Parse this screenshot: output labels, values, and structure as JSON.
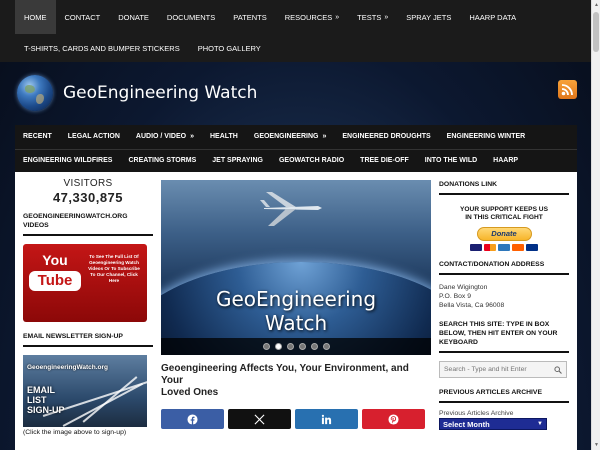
{
  "colors": {
    "nav_bg": "#1b1b1b",
    "content_bg": "#ffffff",
    "facebook": "#3b5ea5",
    "twitter": "#111111",
    "linkedin": "#2870b0",
    "pinterest": "#d7202e",
    "rss": "#f28a2a",
    "archive_select": "#1e2c94"
  },
  "topnav": {
    "row1": [
      {
        "label": "HOME",
        "active": true
      },
      {
        "label": "CONTACT"
      },
      {
        "label": "DONATE"
      },
      {
        "label": "DOCUMENTS"
      },
      {
        "label": "PATENTS"
      },
      {
        "label": "RESOURCES",
        "arrow": "»"
      },
      {
        "label": "TESTS",
        "arrow": "»"
      },
      {
        "label": "SPRAY JETS"
      },
      {
        "label": "HAARP DATA"
      }
    ],
    "row2": [
      {
        "label": "T-SHIRTS, CARDS AND BUMPER STICKERS"
      },
      {
        "label": "PHOTO GALLERY"
      }
    ]
  },
  "header": {
    "site_title": "GeoEngineering Watch",
    "logo_icon": "globe-icon",
    "feed_icon": "rss-icon"
  },
  "mainnav": {
    "row1": [
      {
        "label": "RECENT"
      },
      {
        "label": "LEGAL ACTION"
      },
      {
        "label": "AUDIO / VIDEO",
        "arrow": "»"
      },
      {
        "label": "HEALTH"
      },
      {
        "label": "GEOENGINEERING",
        "arrow": "»"
      },
      {
        "label": "ENGINEERED DROUGHTS"
      },
      {
        "label": "ENGINEERING WINTER"
      }
    ],
    "row2": [
      {
        "label": "ENGINEERING WILDFIRES"
      },
      {
        "label": "CREATING STORMS"
      },
      {
        "label": "JET SPRAYING"
      },
      {
        "label": "GEOWATCH RADIO"
      },
      {
        "label": "TREE DIE-OFF"
      },
      {
        "label": "INTO THE WILD"
      },
      {
        "label": "HAARP"
      }
    ]
  },
  "left": {
    "visitors_label": "VISITORS",
    "visitors_count": "47,330,875",
    "videos_heading_l1": "GEOENGINEERINGWATCH.ORG",
    "videos_heading_l2": "VIDEOS",
    "yt_you": "You",
    "yt_tube": "Tube",
    "yt_text": "To See The Full List Of Geoengineering Watch Videos Or To Subscribe To Our Channel, Click Here",
    "newsletter_heading": "EMAIL NEWSLETTER SIGN-UP",
    "signup_site": "GeoengineeringWatch.org",
    "signup_l1": "EMAIL",
    "signup_l2": "LIST",
    "signup_l3": "SIGN-UP",
    "signup_caption": "(Click the image above to sign-up)"
  },
  "center": {
    "slide_title_l1": "GeoEngineering",
    "slide_title_l2": "Watch",
    "slide_count": 6,
    "active_slide": 2,
    "headline_l1": "Geoengineering Affects You, Your Environment, and Your",
    "headline_l2": "Loved Ones",
    "share_buttons": [
      "facebook-icon",
      "x-icon",
      "linkedin-icon",
      "pinterest-icon"
    ]
  },
  "right": {
    "donations_heading": "DONATIONS LINK",
    "support_l1": "YOUR SUPPORT KEEPS US",
    "support_l2": "IN THIS CRITICAL FIGHT",
    "donate_label": "Donate",
    "address_heading": "CONTACT/DONATION ADDRESS",
    "address_l1": "Dane Wigington",
    "address_l2": "P.O. Box 9",
    "address_l3": "Bella Vista, Ca 96008",
    "search_heading_l1": "SEARCH THIS SITE: TYPE IN BOX",
    "search_heading_l2": "BELOW, THEN HIT ENTER ON YOUR",
    "search_heading_l3": "KEYBOARD",
    "search_placeholder": "Search - Type and hit Enter",
    "archive_heading": "PREVIOUS ARTICLES ARCHIVE",
    "archive_label": "Previous Articles Archive",
    "archive_select": "Select Month"
  }
}
